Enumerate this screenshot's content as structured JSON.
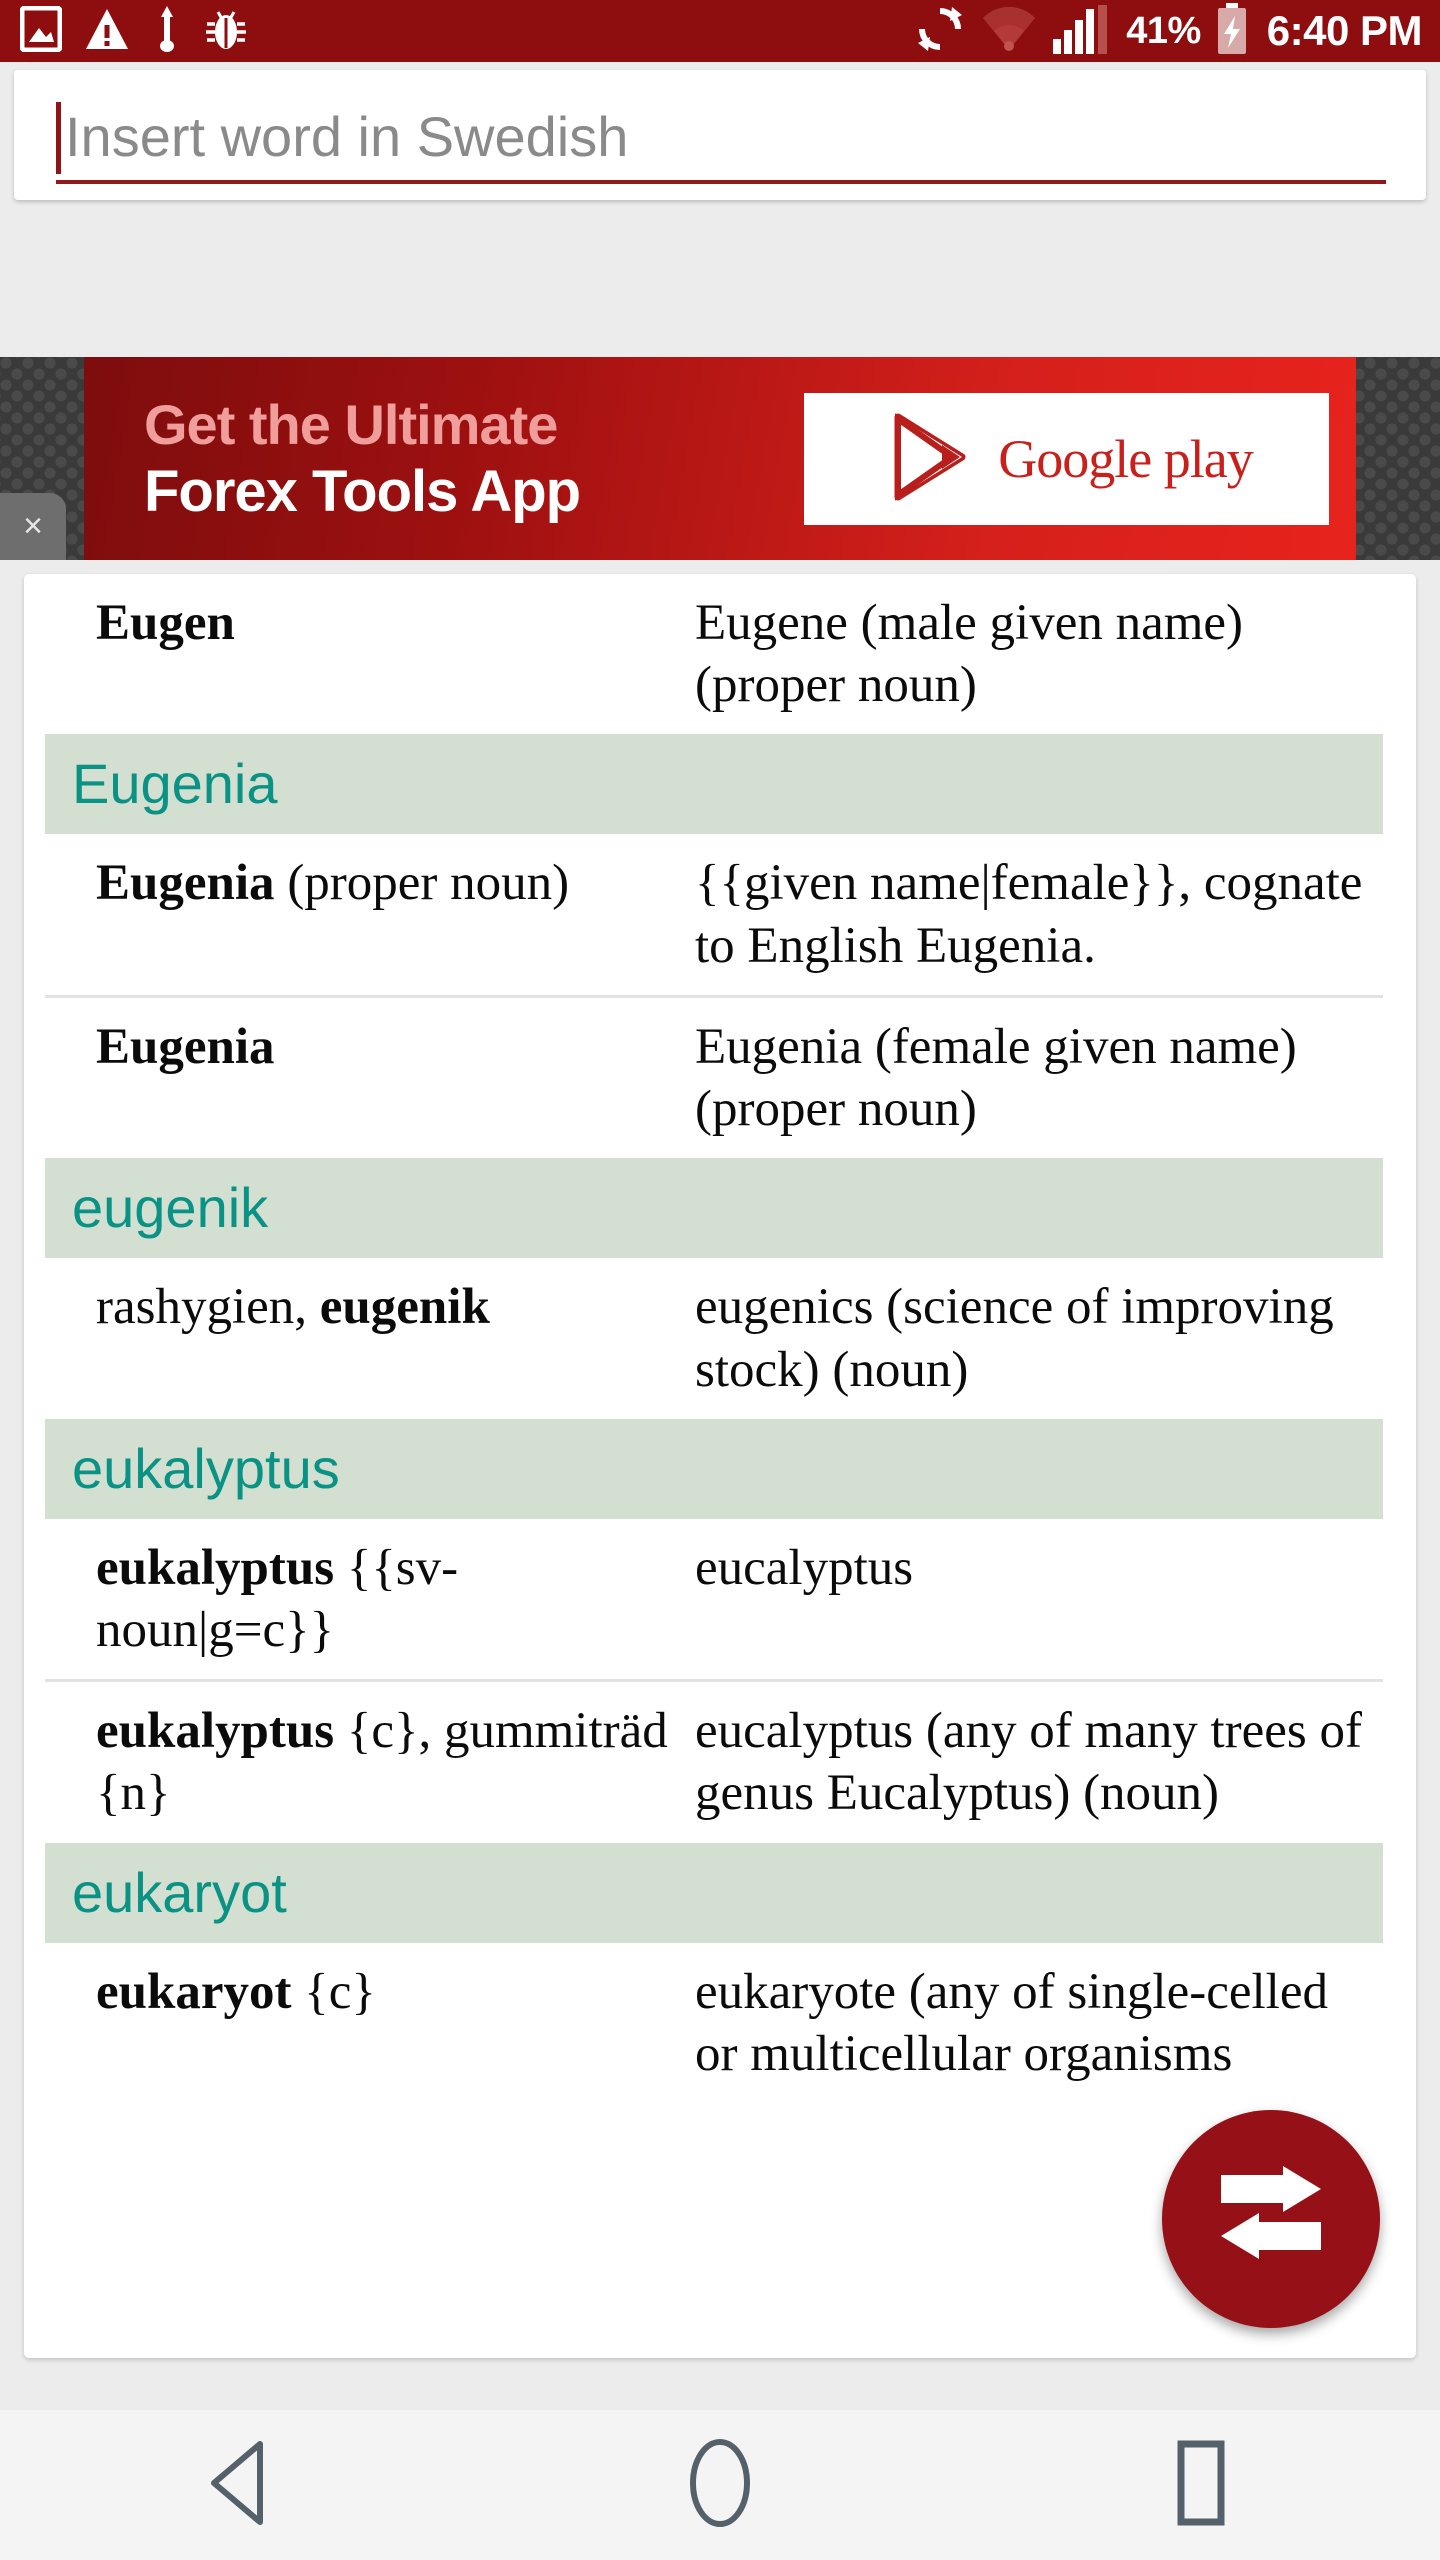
{
  "status_bar": {
    "background": "#8e0e10",
    "left_icons": [
      "image-icon",
      "warning-icon",
      "usb-icon",
      "bug-icon"
    ],
    "right_icons": [
      "sync-icon",
      "wifi-icon",
      "signal-icon"
    ],
    "battery_percent": "41%",
    "battery_icon": "battery-charging-icon",
    "clock": "6:40 PM"
  },
  "search": {
    "placeholder": "Insert word in Swedish",
    "value": "",
    "underline_color": "#8e1a1c"
  },
  "ad": {
    "line1": "Get the Ultimate",
    "line2": "Forex Tools App",
    "badge_label": "Google play",
    "badge_icon": "google-play-triangle-icon",
    "close_label": "×"
  },
  "results": {
    "header_bg": "#d2dfd1",
    "header_text_color": "#0a9384",
    "sections": [
      {
        "header": null,
        "entries": [
          {
            "source_plain": "",
            "source_bold": "Eugen",
            "source_tail": "",
            "target": "Eugene (male given name) (proper noun)",
            "divided": false
          }
        ]
      },
      {
        "header": "Eugenia",
        "entries": [
          {
            "source_plain": "",
            "source_bold": "Eugenia",
            "source_tail": " (proper noun)",
            "target": "{{given name|female}}, cognate to English Eugenia.",
            "divided": false
          },
          {
            "source_plain": "",
            "source_bold": "Eugenia",
            "source_tail": "",
            "target": "Eugenia (female given name) (proper noun)",
            "divided": true
          }
        ]
      },
      {
        "header": "eugenik",
        "entries": [
          {
            "source_plain": "rashygien, ",
            "source_bold": "eugenik",
            "source_tail": "",
            "target": "eugenics (science of improving stock) (noun)",
            "divided": false
          }
        ]
      },
      {
        "header": "eukalyptus",
        "entries": [
          {
            "source_plain": "",
            "source_bold": "eukalyptus",
            "source_tail": " {{sv-noun|g=c}}",
            "target": "eucalyptus",
            "divided": false
          },
          {
            "source_plain": "",
            "source_bold": "eukalyptus",
            "source_tail": " {c}, gummiträd {n}",
            "target": "eucalyptus (any of many trees of genus Eucalyptus) (noun)",
            "divided": true
          }
        ]
      },
      {
        "header": "eukaryot",
        "entries": [
          {
            "source_plain": "",
            "source_bold": "eukaryot",
            "source_tail": " {c}",
            "target": "eukaryote (any of single-celled or multicellular organisms",
            "divided": false
          }
        ]
      }
    ]
  },
  "fab": {
    "icon": "swap-arrows-icon",
    "color": "#961117"
  },
  "nav_bar": {
    "back_icon": "back-triangle-icon",
    "home_icon": "home-circle-icon",
    "recents_icon": "recents-square-icon"
  }
}
